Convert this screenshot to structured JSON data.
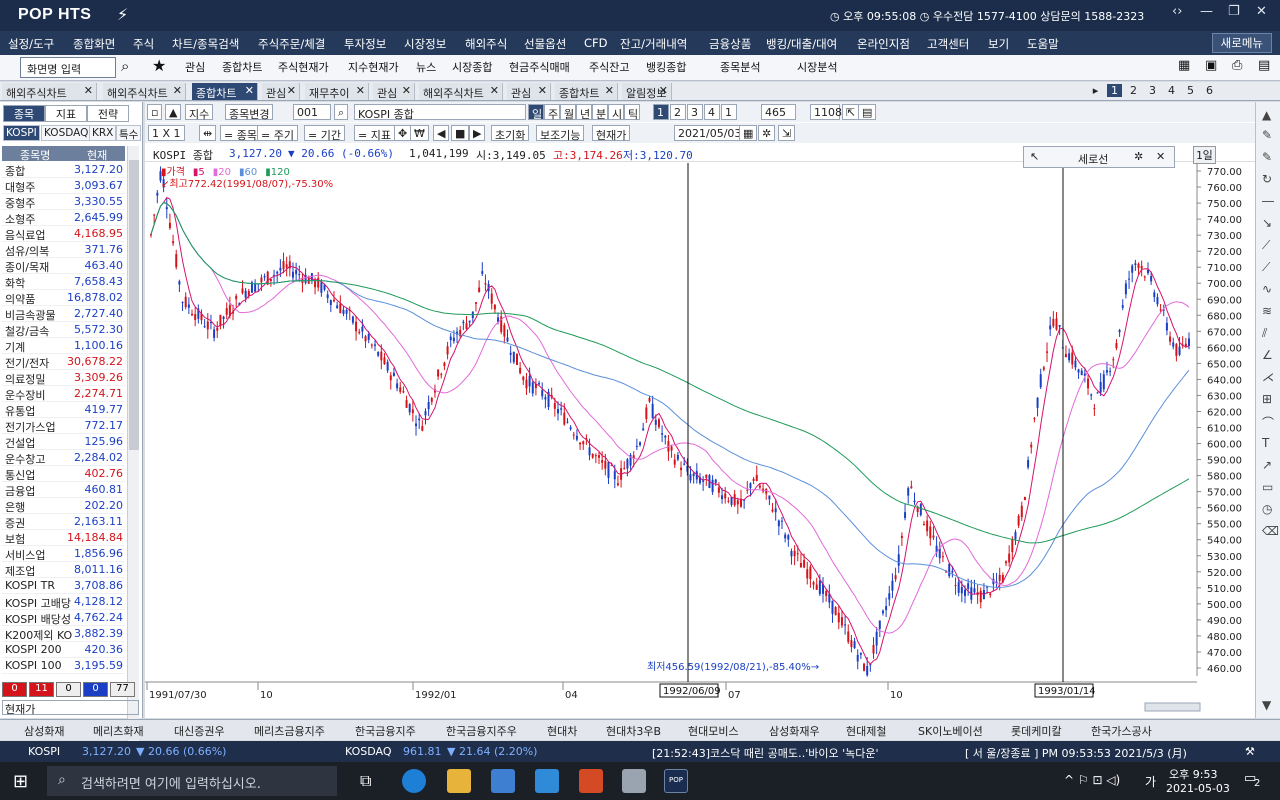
{
  "titlebar": {
    "logo": "POP HTS",
    "clock": "오후 09:55:08",
    "phone": "우수전담 1577-4100 상담문의 1588-2323"
  },
  "menu": [
    "설정/도구",
    "종합화면",
    "주식",
    "차트/종목검색",
    "주식주문/체결",
    "투자정보",
    "시장정보",
    "해외주식",
    "선물옵션",
    "CFD",
    "잔고/거래내역",
    "금융상품",
    "뱅킹/대출/대여",
    "온라인지점",
    "고객센터",
    "보기",
    "도움말"
  ],
  "new_window": "새로메뉴",
  "toolbar": {
    "screen_input": "화면명 입력",
    "items": [
      "관심",
      "종합차트",
      "주식현재가",
      "지수현재가",
      "뉴스",
      "시장종합",
      "현금주식매매",
      "주식잔고",
      "뱅킹종합",
      "종목분석",
      "시장분석"
    ]
  },
  "tabs": [
    "해외주식차트",
    "해외주식차트",
    "종합차트",
    "관심",
    "재무추이",
    "관심",
    "해외주식차트",
    "관심",
    "종합차트",
    "알림정보"
  ],
  "pages": [
    "1",
    "2",
    "3",
    "4",
    "5",
    "6"
  ],
  "left": {
    "tabs": [
      "종목",
      "지표",
      "전략"
    ],
    "markets": [
      "KOSPI",
      "KOSDAQ",
      "KRX",
      "특수"
    ],
    "headers": [
      "종목명",
      "현재"
    ],
    "rows": [
      {
        "name": "종합",
        "value": "3,127.20",
        "dir": "dn"
      },
      {
        "name": "대형주",
        "value": "3,093.67",
        "dir": "dn"
      },
      {
        "name": "중형주",
        "value": "3,330.55",
        "dir": "dn"
      },
      {
        "name": "소형주",
        "value": "2,645.99",
        "dir": "dn"
      },
      {
        "name": "음식료업",
        "value": "4,168.95",
        "dir": "up"
      },
      {
        "name": "섬유/의복",
        "value": "371.76",
        "dir": "dn"
      },
      {
        "name": "종이/목재",
        "value": "463.40",
        "dir": "dn"
      },
      {
        "name": "화학",
        "value": "7,658.43",
        "dir": "dn"
      },
      {
        "name": "의약품",
        "value": "16,878.02",
        "dir": "dn"
      },
      {
        "name": "비금속광물",
        "value": "2,727.40",
        "dir": "dn"
      },
      {
        "name": "철강/금속",
        "value": "5,572.30",
        "dir": "dn"
      },
      {
        "name": "기계",
        "value": "1,100.16",
        "dir": "dn"
      },
      {
        "name": "전기/전자",
        "value": "30,678.22",
        "dir": "up"
      },
      {
        "name": "의료정밀",
        "value": "3,309.26",
        "dir": "up"
      },
      {
        "name": "운수장비",
        "value": "2,274.71",
        "dir": "up"
      },
      {
        "name": "유통업",
        "value": "419.77",
        "dir": "dn"
      },
      {
        "name": "전기가스업",
        "value": "772.17",
        "dir": "dn"
      },
      {
        "name": "건설업",
        "value": "125.96",
        "dir": "dn"
      },
      {
        "name": "운수창고",
        "value": "2,284.02",
        "dir": "dn"
      },
      {
        "name": "통신업",
        "value": "402.76",
        "dir": "up"
      },
      {
        "name": "금융업",
        "value": "460.81",
        "dir": "dn"
      },
      {
        "name": "은행",
        "value": "202.20",
        "dir": "dn"
      },
      {
        "name": "증권",
        "value": "2,163.11",
        "dir": "dn"
      },
      {
        "name": "보험",
        "value": "14,184.84",
        "dir": "up"
      },
      {
        "name": "서비스업",
        "value": "1,856.96",
        "dir": "dn"
      },
      {
        "name": "제조업",
        "value": "8,011.16",
        "dir": "dn"
      },
      {
        "name": "KOSPI TR",
        "value": "3,708.86",
        "dir": "dn"
      },
      {
        "name": "KOSPI 고배당",
        "value": "4,128.12",
        "dir": "dn"
      },
      {
        "name": "KOSPI 배당성",
        "value": "4,762.24",
        "dir": "dn"
      },
      {
        "name": "K200제외 KO",
        "value": "3,882.39",
        "dir": "dn"
      },
      {
        "name": "KOSPI 200",
        "value": "420.36",
        "dir": "dn"
      },
      {
        "name": "KOSPI 100",
        "value": "3,195.59",
        "dir": "dn"
      }
    ],
    "counts": [
      "0",
      "11",
      "0",
      "0",
      "77"
    ],
    "footer": "현재가"
  },
  "chart_toolbar": {
    "index": "지수",
    "change": "종목변경",
    "code": "001",
    "name": "KOSPI 종합",
    "periods": [
      "일",
      "주",
      "월",
      "년",
      "분",
      "시",
      "틱"
    ],
    "nums": [
      "1",
      "2",
      "3",
      "4",
      "1"
    ],
    "count": "465",
    "total": "1108",
    "row2": [
      "1 X 1",
      "= 종목",
      "= 주기",
      "= 기간",
      "= 지표",
      "초기화",
      "보조기능",
      "현재가",
      "2021/05/03"
    ]
  },
  "info": {
    "name": "KOSPI 종합",
    "price": "3,127.20",
    "change": "20.66",
    "pct": "(-0.66%)",
    "volume": "1,041,199",
    "open": "시:3,149.05",
    "high": "고:3,174.26",
    "low": "저:3,120.70"
  },
  "legend": {
    "price": "가격",
    "mas": [
      "5",
      "20",
      "60",
      "120"
    ],
    "max_note": "최고772.42(1991/08/07),-75.30%",
    "min_note": "최저456.59(1992/08/21),-85.40%"
  },
  "tool_popup": {
    "title": "세로선",
    "interval": "1일"
  },
  "vlines": [
    {
      "date": "1992/06/09",
      "label": "1992/06/09"
    },
    {
      "date": "1993/01/14",
      "label": "1993/01/14"
    }
  ],
  "chart_data": {
    "type": "candlestick",
    "x_labels": [
      "1991/07/30",
      "10",
      "1992/01",
      "04",
      "07",
      "10"
    ],
    "y_ticks": [
      "460.00",
      "470.00",
      "480.00",
      "490.00",
      "500.00",
      "510.00",
      "520.00",
      "530.00",
      "540.00",
      "550.00",
      "560.00",
      "570.00",
      "580.00",
      "590.00",
      "600.00",
      "610.00",
      "620.00",
      "630.00",
      "640.00",
      "650.00",
      "660.00",
      "670.00",
      "680.00",
      "690.00",
      "700.00",
      "710.00",
      "720.00",
      "730.00",
      "740.00",
      "750.00",
      "760.00",
      "770.00"
    ],
    "ylim": [
      455,
      775
    ],
    "trend": [
      [
        0,
        730
      ],
      [
        0.01,
        772
      ],
      [
        0.03,
        690
      ],
      [
        0.06,
        670
      ],
      [
        0.09,
        695
      ],
      [
        0.13,
        710
      ],
      [
        0.16,
        700
      ],
      [
        0.19,
        680
      ],
      [
        0.22,
        655
      ],
      [
        0.24,
        635
      ],
      [
        0.26,
        610
      ],
      [
        0.27,
        630
      ],
      [
        0.29,
        665
      ],
      [
        0.31,
        680
      ],
      [
        0.32,
        705
      ],
      [
        0.34,
        670
      ],
      [
        0.36,
        640
      ],
      [
        0.38,
        630
      ],
      [
        0.4,
        615
      ],
      [
        0.43,
        590
      ],
      [
        0.45,
        578
      ],
      [
        0.47,
        600
      ],
      [
        0.48,
        625
      ],
      [
        0.5,
        595
      ],
      [
        0.52,
        580
      ],
      [
        0.54,
        575
      ],
      [
        0.57,
        560
      ],
      [
        0.58,
        580
      ],
      [
        0.6,
        560
      ],
      [
        0.62,
        530
      ],
      [
        0.64,
        515
      ],
      [
        0.66,
        495
      ],
      [
        0.68,
        470
      ],
      [
        0.69,
        458
      ],
      [
        0.7,
        480
      ],
      [
        0.72,
        525
      ],
      [
        0.73,
        575
      ],
      [
        0.74,
        560
      ],
      [
        0.76,
        530
      ],
      [
        0.78,
        510
      ],
      [
        0.8,
        505
      ],
      [
        0.82,
        515
      ],
      [
        0.84,
        560
      ],
      [
        0.85,
        610
      ],
      [
        0.86,
        650
      ],
      [
        0.87,
        680
      ],
      [
        0.88,
        660
      ],
      [
        0.9,
        640
      ],
      [
        0.91,
        625
      ],
      [
        0.93,
        660
      ],
      [
        0.94,
        700
      ],
      [
        0.95,
        715
      ],
      [
        0.96,
        705
      ],
      [
        0.97,
        690
      ],
      [
        0.98,
        670
      ],
      [
        0.99,
        655
      ],
      [
        1.0,
        665
      ]
    ],
    "close": "3,127.20"
  },
  "quicktabs": [
    "삼성화재",
    "메리츠화재",
    "대신증권우",
    "메리츠금융지주",
    "한국금융지주",
    "한국금융지주우",
    "현대차",
    "현대차3우B",
    "현대모비스",
    "삼성화재우",
    "현대제철",
    "SK이노베이션",
    "롯데케미칼",
    "한국가스공사"
  ],
  "status": {
    "kospi": "KOSPI",
    "kospi_val": "3,127.20",
    "kospi_chg": "▼ 20.66 (0.66%)",
    "kosdaq": "KOSDAQ",
    "kosdaq_val": "961.81",
    "kosdaq_chg": "▼ 21.64 (2.20%)",
    "news": "[21:52:43]코스닥 때린 공매도‥'바이오 '녹다운'",
    "right": "[ 서 울/장종료 ] PM 09:53:53 2021/5/3 (月)"
  },
  "taskbar": {
    "search": "검색하려면 여기에 입력하십시오.",
    "time": "오후 9:53",
    "date": "2021-05-03",
    "lang": "가",
    "notify": "2"
  },
  "colors": {
    "up": "#d4141a",
    "down": "#1a3fc4",
    "ma5": "#d6136b",
    "ma20": "#e26ad9",
    "ma60": "#5b8fd9",
    "ma120": "#1f9a5a"
  }
}
